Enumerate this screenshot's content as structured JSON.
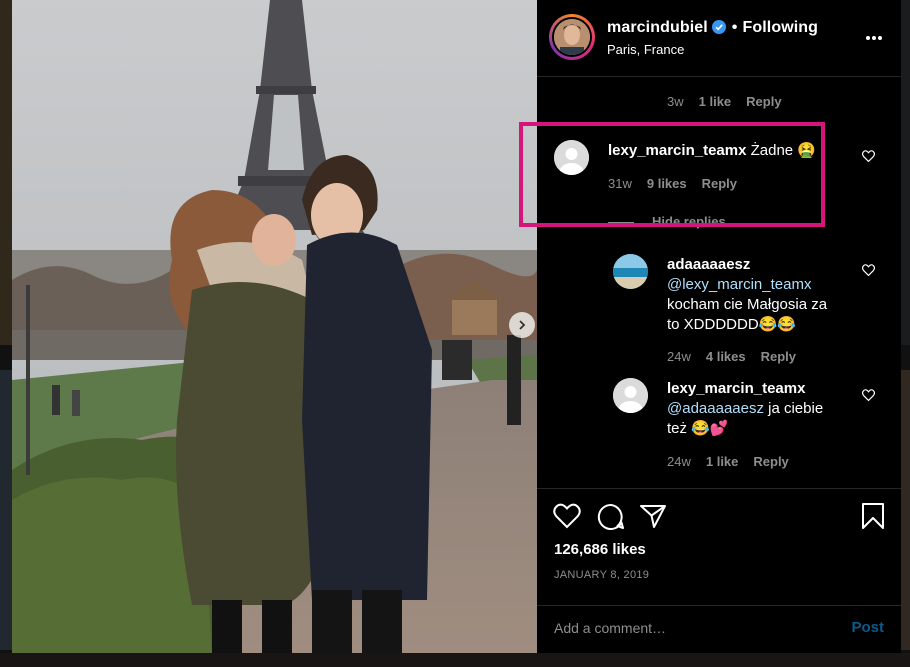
{
  "post": {
    "username": "marcindubiel",
    "follow_status": "Following",
    "location": "Paris, France",
    "likes": "126,686 likes",
    "date": "JANUARY 8, 2019"
  },
  "comments": {
    "top_meta": {
      "time": "3w",
      "likes": "1 like",
      "reply": "Reply"
    },
    "main": {
      "username": "lexy_marcin_teamx",
      "text": "Żadne 🤮",
      "time": "31w",
      "likes": "9 likes",
      "reply": "Reply",
      "hide_replies": "Hide replies"
    },
    "replies": [
      {
        "username": "adaaaaaesz",
        "mention": "@lexy_marcin_teamx",
        "text_line2": "kocham cie Małgosia za",
        "text_line3": "to XDDDDDD😂😂",
        "time": "24w",
        "likes": "4 likes",
        "reply": "Reply"
      },
      {
        "username": "lexy_marcin_teamx",
        "mention": "@adaaaaaesz",
        "text_after_mention": " ja ciebie",
        "text_line2": "też 😂💕",
        "time": "24w",
        "likes": "1 like",
        "reply": "Reply"
      }
    ]
  },
  "add_comment": {
    "placeholder": "Add a comment…",
    "post_label": "Post"
  },
  "colors": {
    "highlight": "#d6157a",
    "verified": "#3897f0",
    "mention": "#b2dffc",
    "post_button": "#0a5a8c"
  },
  "icons": [
    "verified-badge-icon",
    "more-options-icon",
    "heart-icon",
    "comment-icon",
    "share-icon",
    "bookmark-icon",
    "next-arrow-icon"
  ]
}
